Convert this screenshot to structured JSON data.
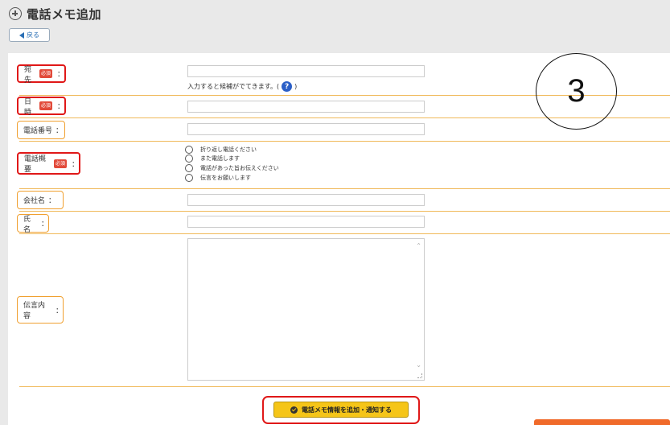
{
  "header": {
    "title": "電話メモ追加",
    "icon": "plus-circle-icon",
    "back_label": "戻る",
    "back_icon": "arrow-left-icon"
  },
  "form": {
    "recipient": {
      "label": "宛先",
      "required_badge": "必須",
      "colon": "：",
      "value": "",
      "hint": "入力すると候補がでてきます。(",
      "hint_close": ")",
      "help_glyph": "?"
    },
    "datetime": {
      "label": "日時",
      "required_badge": "必須",
      "colon": "：",
      "value": ""
    },
    "phone": {
      "label": "電話番号",
      "colon": "：",
      "value": ""
    },
    "summary": {
      "label": "電話概要",
      "required_badge": "必須",
      "colon": "：",
      "options": [
        "折り返し電話ください",
        "また電話します",
        "電話があった旨お伝えください",
        "伝言をお願いします"
      ]
    },
    "company": {
      "label": "会社名",
      "colon": "：",
      "value": ""
    },
    "name": {
      "label": "氏名",
      "colon": "：",
      "value": ""
    },
    "message": {
      "label": "伝言内容",
      "colon": "：",
      "value": ""
    }
  },
  "submit": {
    "label": "電話メモ情報を追加・通知する",
    "icon": "check-circle-icon"
  },
  "annotation": {
    "step_number": "3"
  },
  "colors": {
    "accent_orange": "#f0a030",
    "required_red": "#e01818",
    "submit_yellow": "#f5c518",
    "link_blue": "#2a6fb5"
  }
}
